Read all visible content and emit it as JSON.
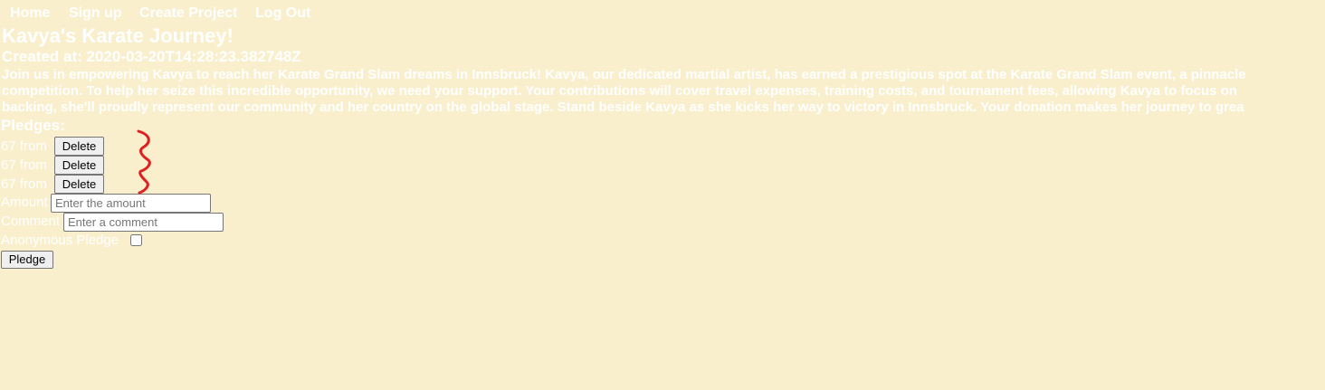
{
  "nav": {
    "home": "Home",
    "signup": "Sign up",
    "create_project": "Create Project",
    "logout": "Log Out"
  },
  "project": {
    "title": "Kavya's Karate Journey!",
    "created": "Created at: 2020-03-20T14:28:23.382748Z",
    "description_lines": [
      "Join us in empowering Kavya to reach her Karate Grand Slam dreams in Innsbruck! Kavya, our dedicated martial artist, has earned a prestigious spot at the Karate Grand Slam event, a pinnacle",
      "competition. To help her seize this incredible opportunity, we need your support. Your contributions will cover travel expenses, training costs, and tournament fees, allowing Kavya to focus on",
      "backing, she'll proudly represent our community and her country on the global stage. Stand beside Kavya as she kicks her way to victory in Innsbruck. Your donation makes her journey to grea"
    ]
  },
  "pledges": {
    "heading": "Pledges:",
    "items": [
      {
        "text": "67 from",
        "delete_label": "Delete"
      },
      {
        "text": "67 from",
        "delete_label": "Delete"
      },
      {
        "text": "67 from",
        "delete_label": "Delete"
      }
    ]
  },
  "form": {
    "amount_label": "Amount",
    "amount_placeholder": "Enter the amount",
    "comment_label": "Comment",
    "comment_placeholder": "Enter a comment",
    "anonymous_label": "Anonymous Pledge",
    "anonymous_checked": false,
    "submit_label": "Pledge"
  },
  "colors": {
    "background": "#f9efcc",
    "text": "#ffffff",
    "annotation": "#e02020"
  }
}
